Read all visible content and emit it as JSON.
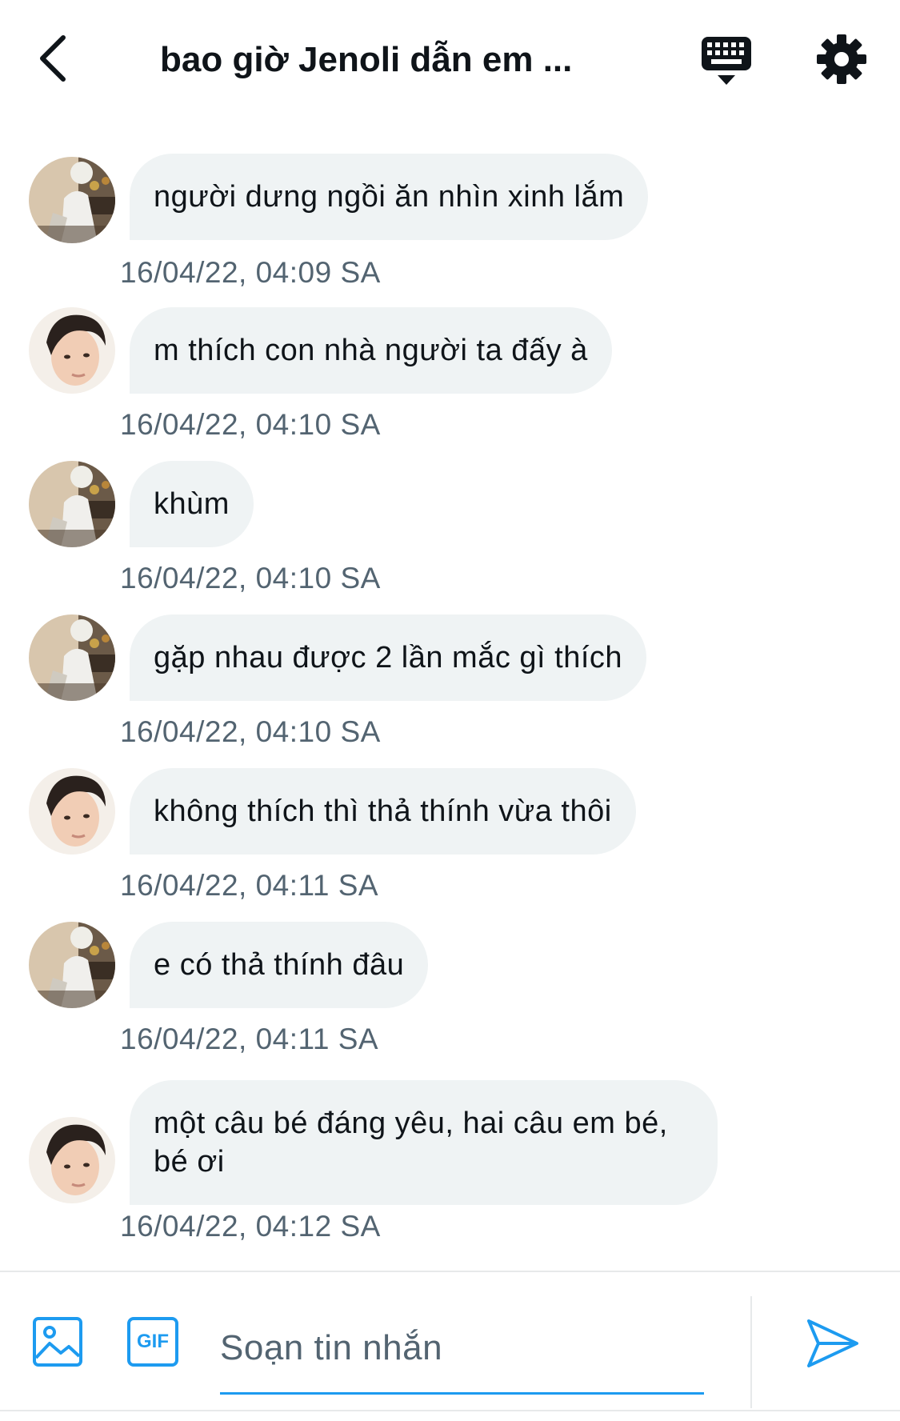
{
  "header": {
    "title": "bao giờ Jenoli dẫn em ...",
    "back_icon": "chevron-left-icon",
    "keyboard_icon": "keyboard-icon",
    "settings_icon": "gear-icon"
  },
  "messages": [
    {
      "text": "người dưng ngồi ăn nhìn xinh lắm",
      "time": "16/04/22, 04:09 SA",
      "avatar": "avatar-a"
    },
    {
      "text": "m thích con nhà người ta đấy à",
      "time": "16/04/22, 04:10 SA",
      "avatar": "avatar-b"
    },
    {
      "text": "khùm",
      "time": "16/04/22, 04:10 SA",
      "avatar": "avatar-a"
    },
    {
      "text": "gặp nhau được 2 lần mắc gì thích",
      "time": "16/04/22, 04:10 SA",
      "avatar": "avatar-a"
    },
    {
      "text": "không thích thì thả thính vừa thôi",
      "time": "16/04/22, 04:11 SA",
      "avatar": "avatar-b"
    },
    {
      "text": "e có thả thính đâu",
      "time": "16/04/22, 04:11 SA",
      "avatar": "avatar-a"
    },
    {
      "text": "một câu bé đáng yêu, hai câu em bé, bé ơi",
      "time": "16/04/22, 04:12 SA",
      "avatar": "avatar-b"
    }
  ],
  "composer": {
    "placeholder": "Soạn tin nhắn",
    "gif_label": "GIF",
    "accent": "#1d9bf0"
  },
  "colors": {
    "bubble": "#eff3f4",
    "timestamp": "#536471",
    "text": "#0f1419"
  }
}
